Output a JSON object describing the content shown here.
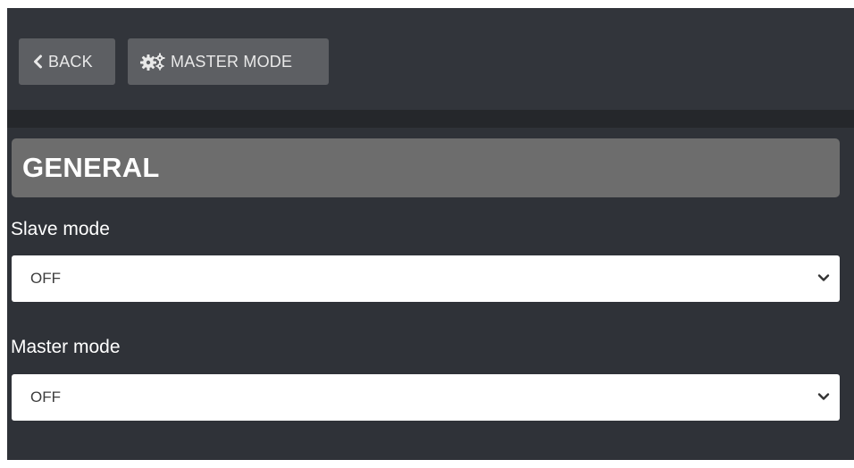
{
  "toolbar": {
    "back_label": "BACK",
    "master_mode_label": "MASTER MODE"
  },
  "section": {
    "title": "GENERAL"
  },
  "fields": {
    "slave_mode": {
      "label": "Slave mode",
      "value": "OFF"
    },
    "master_mode": {
      "label": "Master mode",
      "value": "OFF"
    }
  },
  "icons": {
    "back": "chevron-left-icon",
    "master_mode": "gears-icon",
    "select_arrow": "chevron-down-icon"
  },
  "colors": {
    "app_background": "#2f3238",
    "toolbar_background": "#32353b",
    "button_background": "#5d5f63",
    "header_background": "#6d6d6d",
    "divider": "#25272b"
  }
}
